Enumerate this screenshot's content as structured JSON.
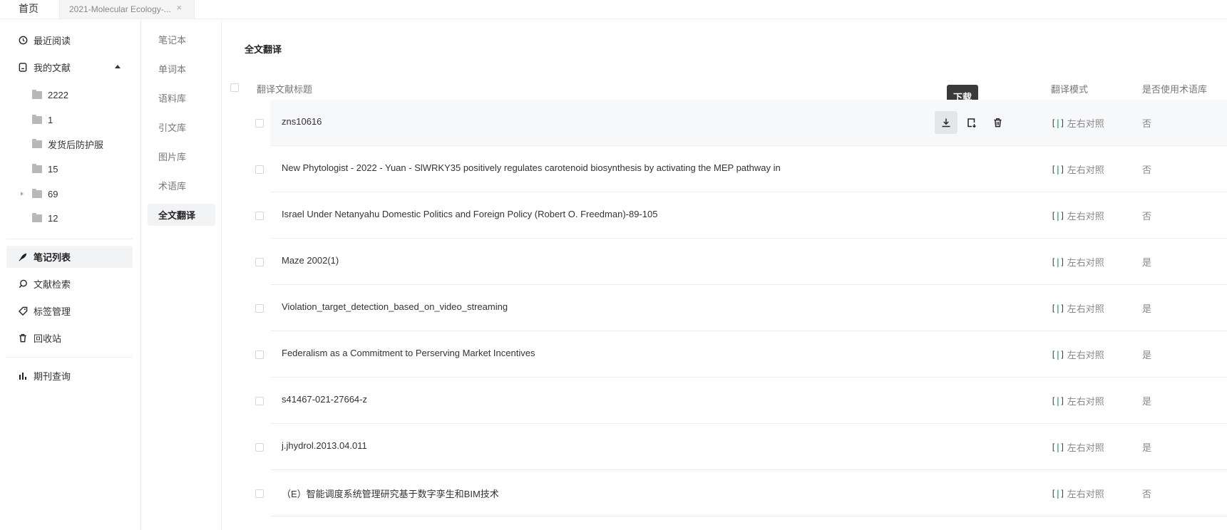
{
  "tabs": {
    "home": "首页",
    "doc": "2021-Molecular Ecology-...",
    "close": "×"
  },
  "sidebar": {
    "recent": "最近阅读",
    "my_docs": "我的文献",
    "folders": [
      "2222",
      "1",
      "发货后防护服",
      "15",
      "69",
      "12"
    ],
    "notes_list": "笔记列表",
    "search": "文献检索",
    "tags": "标签管理",
    "trash": "回收站",
    "journals": "期刊查询"
  },
  "subnav": {
    "items": [
      "笔记本",
      "单词本",
      "语料库",
      "引文库",
      "图片库",
      "术语库",
      "全文翻译"
    ]
  },
  "main": {
    "title": "全文翻译",
    "headers": {
      "title": "翻译文献标题",
      "mode": "翻译模式",
      "term": "是否使用术语库"
    },
    "tooltip": "下载",
    "rows": [
      {
        "title": "zns10616",
        "mode": "左右对照",
        "term": "否"
      },
      {
        "title": "New Phytologist - 2022 - Yuan - SlWRKY35 positively regulates carotenoid biosynthesis by activating the MEP pathway in",
        "mode": "左右对照",
        "term": "否"
      },
      {
        "title": "Israel Under Netanyahu Domestic Politics and Foreign Policy (Robert O. Freedman)-89-105",
        "mode": "左右对照",
        "term": "否"
      },
      {
        "title": "Maze 2002(1)",
        "mode": "左右对照",
        "term": "是"
      },
      {
        "title": "Violation_target_detection_based_on_video_streaming",
        "mode": "左右对照",
        "term": "是"
      },
      {
        "title": "Federalism as a Commitment to Perserving Market Incentives",
        "mode": "左右对照",
        "term": "是"
      },
      {
        "title": "s41467-021-27664-z",
        "mode": "左右对照",
        "term": "是"
      },
      {
        "title": "j.jhydrol.2013.04.011",
        "mode": "左右对照",
        "term": "是"
      },
      {
        "title": "（E）智能调度系统管理研究基于数字孪生和BIM技术",
        "mode": "左右对照",
        "term": "否"
      }
    ]
  }
}
